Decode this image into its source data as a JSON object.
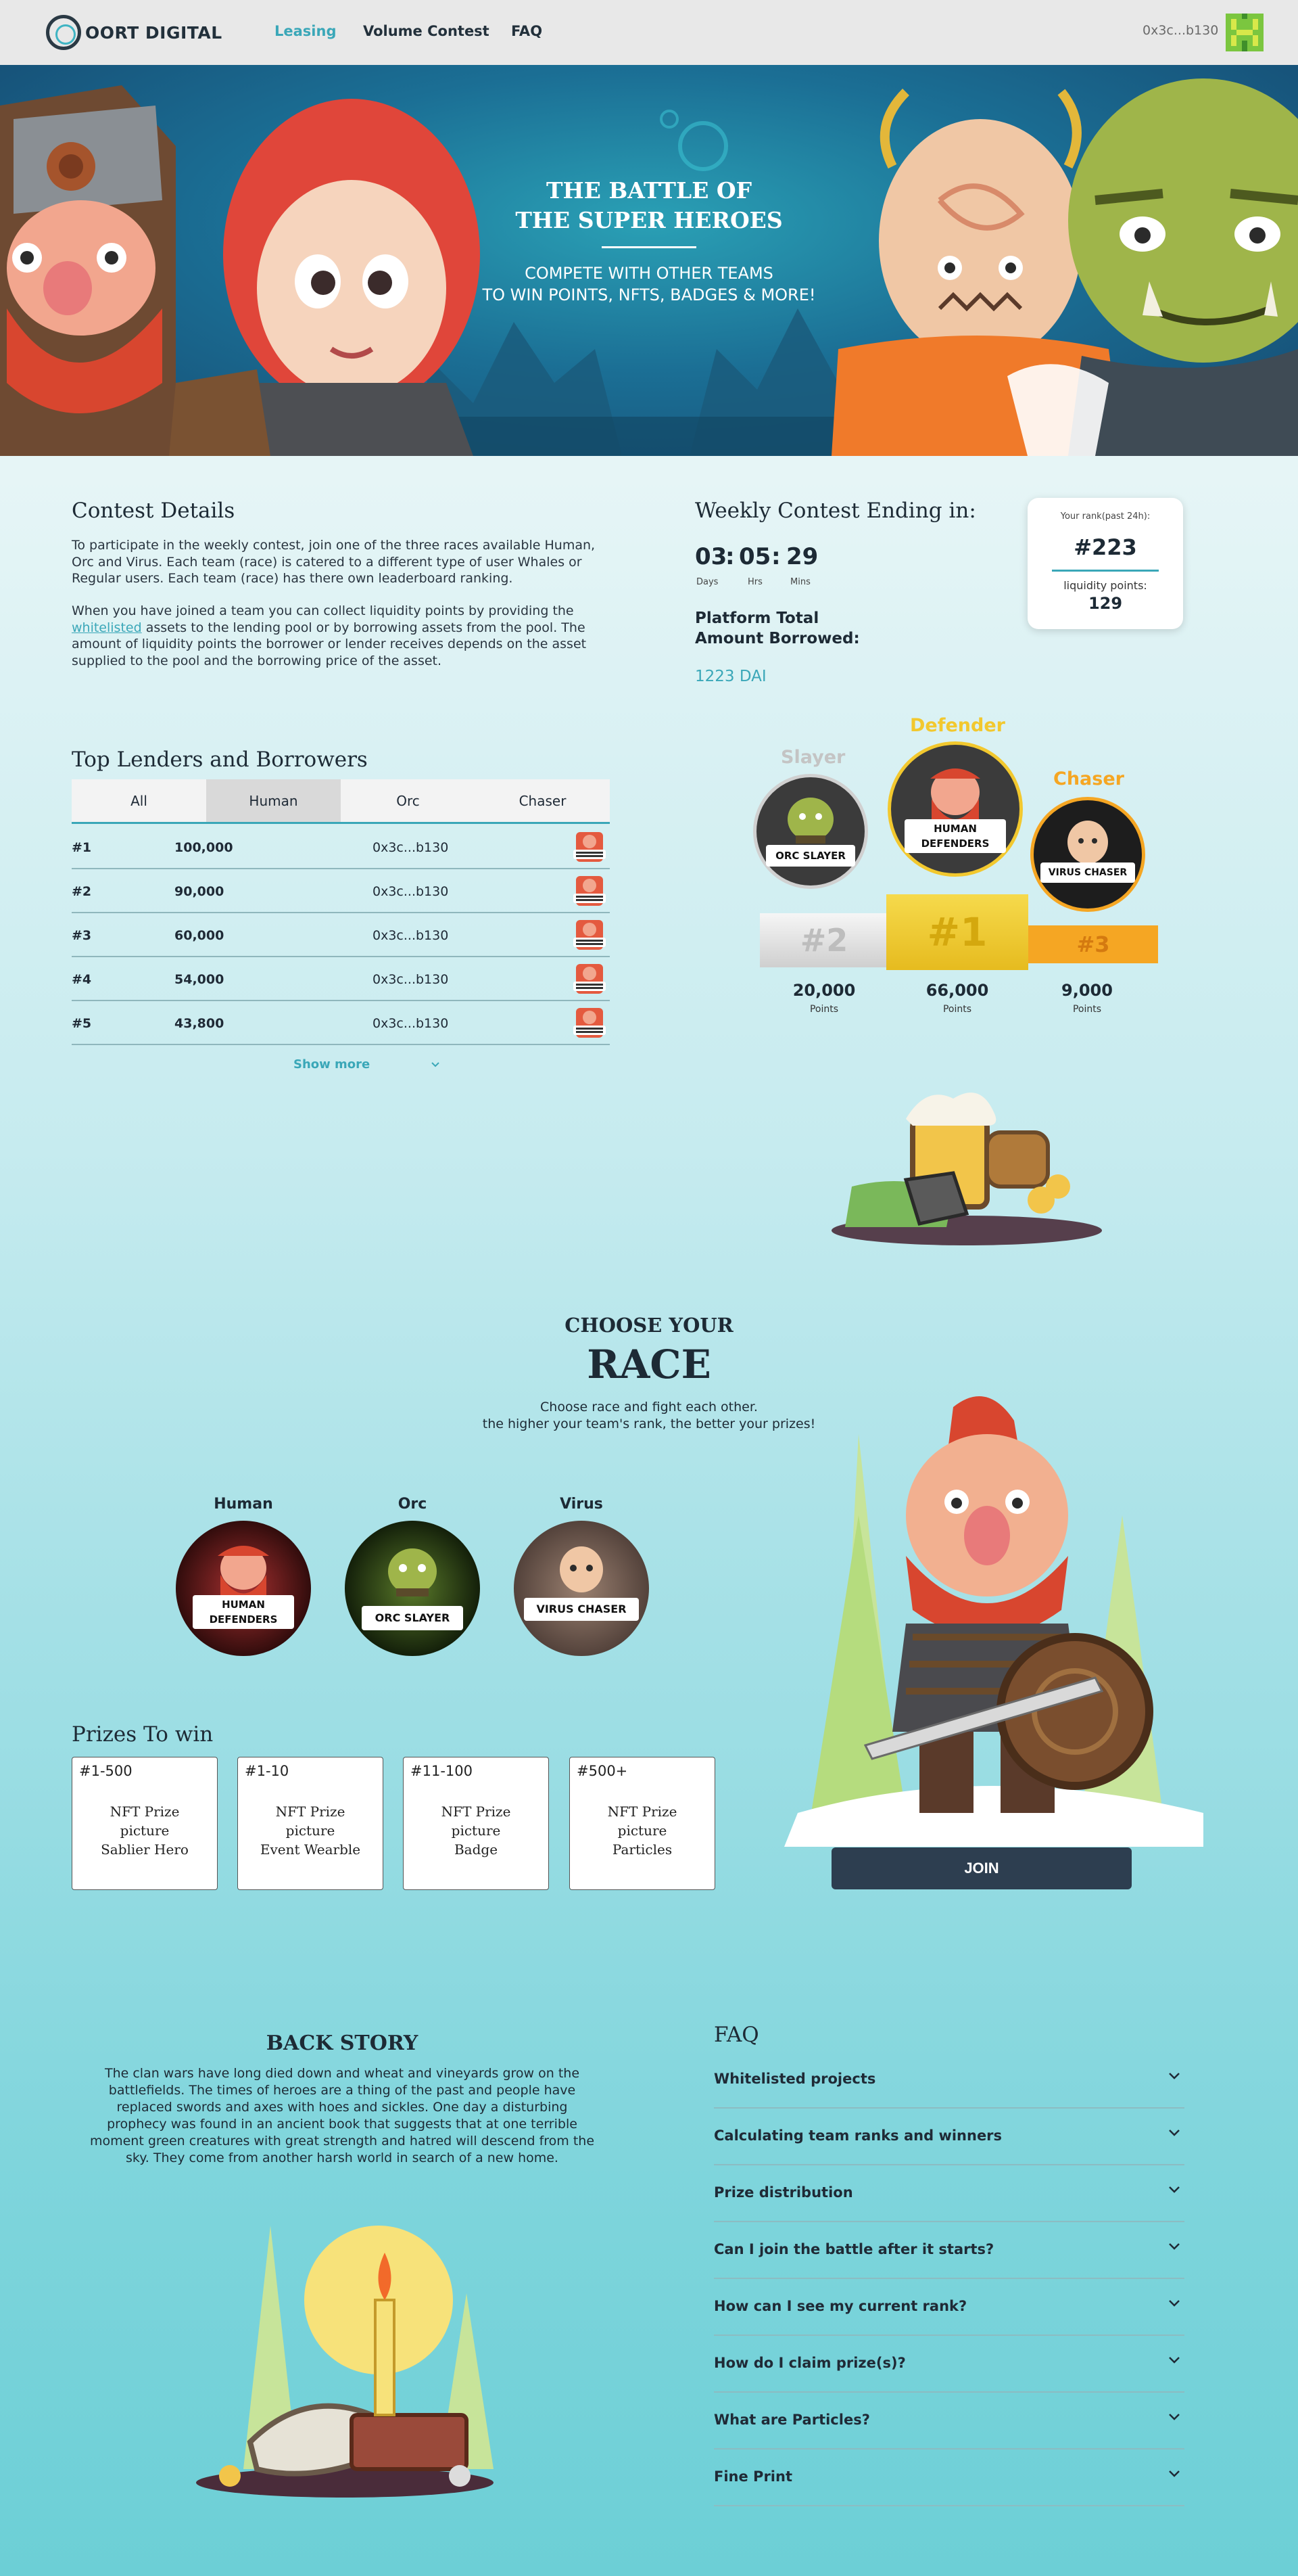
{
  "nav": {
    "brand": "OORT DIGITAL",
    "links": [
      "Leasing",
      "Volume Contest",
      "FAQ"
    ],
    "active_link": "Leasing",
    "wallet": "0x3c...b130"
  },
  "hero": {
    "title_line1": "THE BATTLE OF",
    "title_line2": "THE SUPER HEROES",
    "subtitle_line1": "COMPETE WITH OTHER TEAMS",
    "subtitle_line2": "TO WIN POINTS, NFTS, BADGES & MORE!"
  },
  "contest": {
    "title": "Contest Details",
    "para1": "To participate in the weekly contest, join one of the three races available Human, Orc and Virus. Each team (race) is catered to a different type of user Whales or Regular users. Each team (race) has there own leaderboard ranking.",
    "para2_before": "When you have joined a team you can collect liquidity points by providing the ",
    "para2_link": "whitelisted",
    "para2_after": " assets to the lending pool or by borrowing assets from the pool. The amount of liquidity points the borrower or lender receives depends on the asset supplied to the pool and the borrowing price of the asset."
  },
  "weekly": {
    "title": "Weekly Contest Ending in:",
    "days": "03",
    "hrs": "05",
    "mins": "29",
    "days_label": "Days",
    "hrs_label": "Hrs",
    "mins_label": "Mins",
    "separator": ":",
    "borrowed_label_line1": "Platform Total",
    "borrowed_label_line2": "Amount Borrowed:",
    "borrowed_value": "1223 DAI"
  },
  "rank_card": {
    "label": "Your rank(past 24h):",
    "rank": "#223",
    "points_label": "liquidity points:",
    "points": "129"
  },
  "leaderboard": {
    "title": "Top Lenders and Borrowers",
    "tabs": [
      "All",
      "Human",
      "Orc",
      "Chaser"
    ],
    "active_tab": "Human",
    "rows": [
      {
        "rank": "#1",
        "points": "100,000",
        "address": "0x3c...b130"
      },
      {
        "rank": "#2",
        "points": "90,000",
        "address": "0x3c...b130"
      },
      {
        "rank": "#3",
        "points": "60,000",
        "address": "0x3c...b130"
      },
      {
        "rank": "#4",
        "points": "54,000",
        "address": "0x3c...b130"
      },
      {
        "rank": "#5",
        "points": "43,800",
        "address": "0x3c...b130"
      }
    ],
    "show_more": "Show more"
  },
  "podium": {
    "first": {
      "team": "Defender",
      "rank": "#1",
      "points": "66,000",
      "badge_top": "HUMAN",
      "badge_bottom": "DEFENDERS"
    },
    "second": {
      "team": "Slayer",
      "rank": "#2",
      "points": "20,000",
      "badge_top": "ORC",
      "badge_bottom": "SLAYER"
    },
    "third": {
      "team": "Chaser",
      "rank": "#3",
      "points": "9,000",
      "badge_top": "VIRUS",
      "badge_bottom": "CHASER"
    },
    "points_label": "Points",
    "colors": {
      "gold": "#f2c82e",
      "silver": "#c4c4c4",
      "orange": "#f5a623"
    }
  },
  "choose": {
    "pre": "CHOOSE YOUR",
    "title": "RACE",
    "line1": "Choose race and fight each other.",
    "line2": "the higher your team's rank, the better your prizes!",
    "races": [
      {
        "name": "Human",
        "badge_top": "HUMAN",
        "badge_bottom": "DEFENDERS"
      },
      {
        "name": "Orc",
        "badge_top": "ORC",
        "badge_bottom": "SLAYER"
      },
      {
        "name": "Virus",
        "badge_top": "VIRUS",
        "badge_bottom": "CHASER"
      }
    ],
    "join": "JOIN"
  },
  "prizes": {
    "title": "Prizes To win",
    "cards": [
      {
        "range": "#1-500",
        "line1": "NFT Prize",
        "line2": "picture",
        "line3": "Sablier Hero"
      },
      {
        "range": "#1-10",
        "line1": "NFT Prize",
        "line2": "picture",
        "line3": "Event Wearble"
      },
      {
        "range": "#11-100",
        "line1": "NFT Prize",
        "line2": "picture",
        "line3": "Badge"
      },
      {
        "range": "#500+",
        "line1": "NFT Prize",
        "line2": "picture",
        "line3": "Particles"
      }
    ]
  },
  "backstory": {
    "title": "BACK STORY",
    "text": "The clan wars have long died down and wheat and vineyards grow on the battlefields. The times of heroes are a thing of the past and people have replaced swords and axes with hoes and sickles. One day a disturbing prophecy was found in an ancient book that suggests that at one terrible moment green creatures with great strength and hatred will descend from the sky.  They come from another harsh world in search of a new home."
  },
  "faq": {
    "title": "FAQ",
    "items": [
      "Whitelisted projects",
      "Calculating team ranks and winners",
      "Prize distribution",
      "Can I join the battle after it starts?",
      "How can I see my current rank?",
      "How do I claim prize(s)?",
      "What are Particles?",
      "Fine Print"
    ]
  }
}
